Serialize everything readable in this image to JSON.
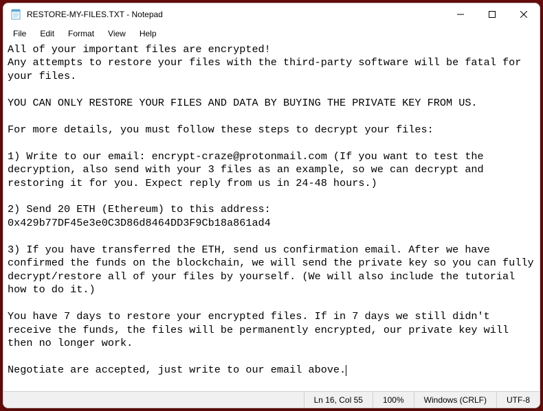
{
  "window": {
    "title": "RESTORE-MY-FILES.TXT - Notepad",
    "icon": "notepad-icon"
  },
  "menu": {
    "file": "File",
    "edit": "Edit",
    "format": "Format",
    "view": "View",
    "help": "Help"
  },
  "content": {
    "body": "All of your important files are encrypted!\nAny attempts to restore your files with the third-party software will be fatal for your files.\n\nYOU CAN ONLY RESTORE YOUR FILES AND DATA BY BUYING THE PRIVATE KEY FROM US.\n\nFor more details, you must follow these steps to decrypt your files:\n\n1) Write to our email: encrypt-craze@protonmail.com (If you want to test the decryption, also send with your 3 files as an example, so we can decrypt and restoring it for you. Expect reply from us in 24-48 hours.)\n\n2) Send 20 ETH (Ethereum) to this address: 0x429b77DF45e3e0C3D86d8464DD3F9Cb18a861ad4\n\n3) If you have transferred the ETH, send us confirmation email. After we have confirmed the funds on the blockchain, we will send the private key so you can fully decrypt/restore all of your files by yourself. (We will also include the tutorial how to do it.)\n\nYou have 7 days to restore your encrypted files. If in 7 days we still didn't receive the funds, the files will be permanently encrypted, our private key will then no longer work.\n\nNegotiate are accepted, just write to our email above."
  },
  "statusbar": {
    "position": "Ln 16, Col 55",
    "zoom": "100%",
    "line_ending": "Windows (CRLF)",
    "encoding": "UTF-8"
  }
}
